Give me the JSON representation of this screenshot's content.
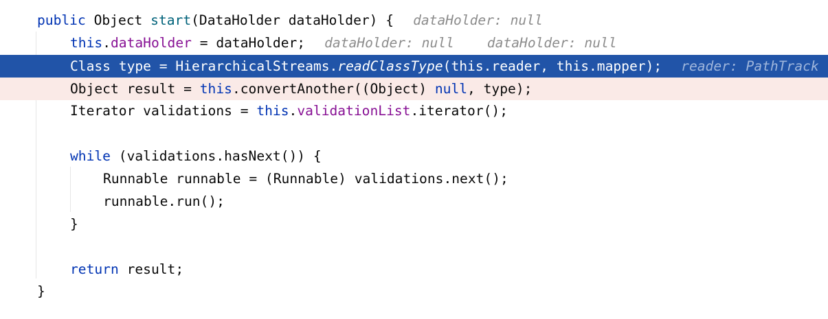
{
  "editor": {
    "lines": [
      {
        "tokens": [
          {
            "t": "public",
            "c": "kw"
          },
          {
            "t": " Object "
          },
          {
            "t": "start",
            "c": "call"
          },
          {
            "t": "(DataHolder dataHolder) {"
          }
        ],
        "hints": [
          "dataHolder: null"
        ]
      },
      {
        "tokens": [
          {
            "t": "this",
            "c": "kw"
          },
          {
            "t": "."
          },
          {
            "t": "dataHolder",
            "c": "fld"
          },
          {
            "t": " = dataHolder;"
          }
        ],
        "hints": [
          "dataHolder: null",
          "dataHolder: null"
        ]
      },
      {
        "tokens": [
          {
            "t": "Class type = HierarchicalStreams."
          },
          {
            "t": "readClassType",
            "c": "it"
          },
          {
            "t": "(this.reader, this.mapper);"
          }
        ],
        "hints": [
          "reader: PathTrack"
        ],
        "state": "exec"
      },
      {
        "tokens": [
          {
            "t": "Object result = "
          },
          {
            "t": "this",
            "c": "kw"
          },
          {
            "t": ".convertAnother((Object) "
          },
          {
            "t": "null",
            "c": "kw"
          },
          {
            "t": ", type);"
          }
        ],
        "state": "bp"
      },
      {
        "tokens": [
          {
            "t": "Iterator validations = "
          },
          {
            "t": "this",
            "c": "kw"
          },
          {
            "t": "."
          },
          {
            "t": "validationList",
            "c": "fld"
          },
          {
            "t": ".iterator();"
          }
        ]
      },
      {
        "tokens": []
      },
      {
        "tokens": [
          {
            "t": "while",
            "c": "kw"
          },
          {
            "t": " (validations.hasNext()) {"
          }
        ]
      },
      {
        "tokens": [
          {
            "t": "Runnable runnable = (Runnable) validations.next();"
          }
        ]
      },
      {
        "tokens": [
          {
            "t": "runnable.run();"
          }
        ]
      },
      {
        "tokens": [
          {
            "t": "}"
          }
        ]
      },
      {
        "tokens": []
      },
      {
        "tokens": [
          {
            "t": "return",
            "c": "kw"
          },
          {
            "t": " result;"
          }
        ]
      },
      {
        "tokens": [
          {
            "t": "}"
          }
        ]
      }
    ]
  },
  "colors": {
    "keyword": "#0033b3",
    "field": "#871094",
    "method_declaration": "#00627a",
    "inline_hint": "#8c8c8c",
    "execution_line_bg": "#2154a8",
    "breakpoint_line_bg": "#faeae7"
  }
}
